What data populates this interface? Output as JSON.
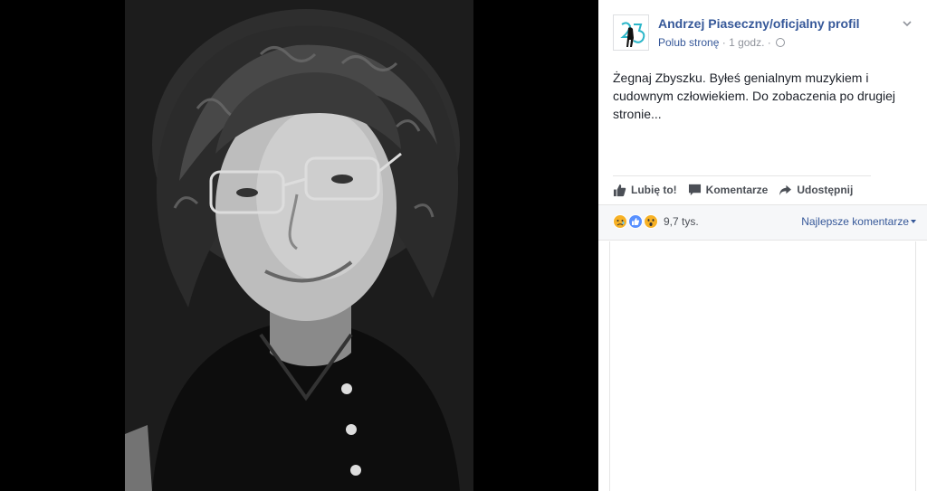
{
  "post": {
    "page_name": "Andrzej Piaseczny/oficjalny profil",
    "like_page": "Polub stronę",
    "separator": "·",
    "time": "1 godz.",
    "separator2": "·",
    "text": "Żegnaj Zbyszku. Byłeś genialnym muzykiem i cudownym człowiekiem. Do zobaczenia po drugiej stronie..."
  },
  "actions": {
    "like": "Lubię to!",
    "comment": "Komentarze",
    "share": "Udostępnij"
  },
  "reactions": {
    "icons": [
      "sad-emoji-icon",
      "like-reaction-icon",
      "wow-emoji-icon"
    ],
    "count": "9,7 tys.",
    "sort_label": "Najlepsze komentarze"
  },
  "colors": {
    "link": "#365899",
    "text": "#1d2129",
    "muted": "#90949c",
    "panel_bg": "#ffffff",
    "stage_bg": "#000000"
  }
}
